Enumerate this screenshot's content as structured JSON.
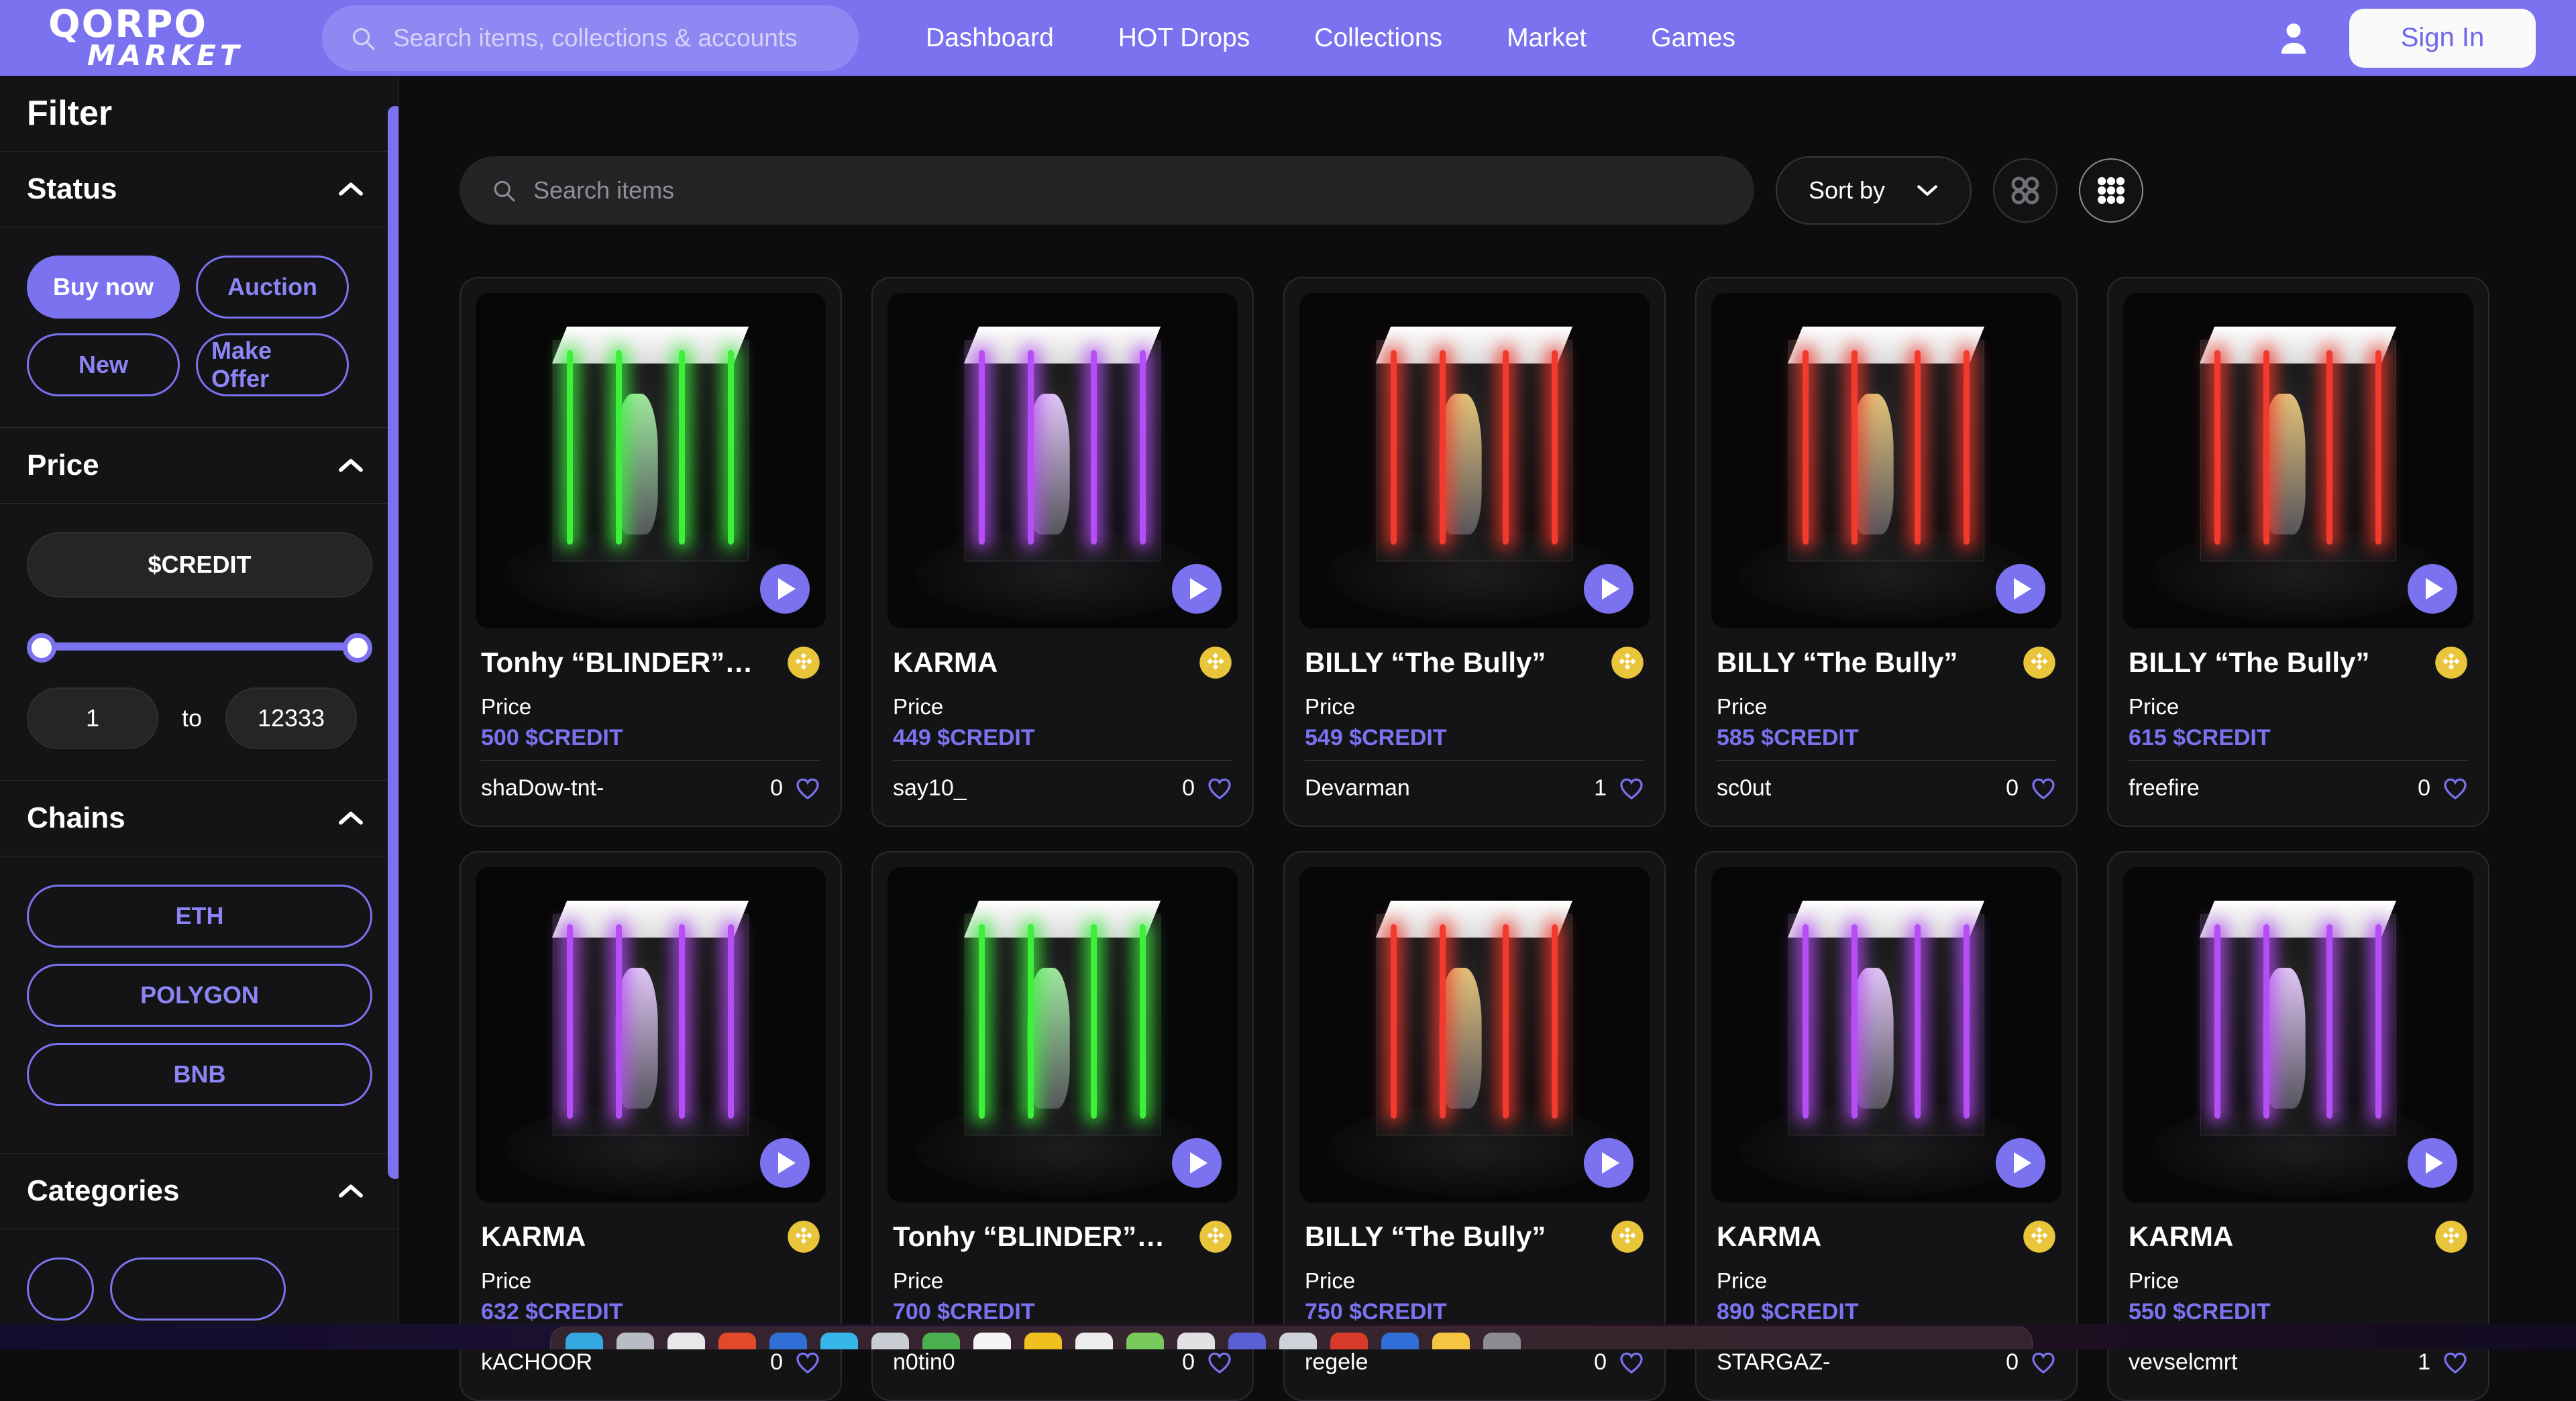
{
  "header": {
    "logo_top": "QORPO",
    "logo_bottom": "MARKET",
    "search_placeholder": "Search items, collections & accounts",
    "search_value": "",
    "nav": [
      {
        "label": "Dashboard"
      },
      {
        "label": "HOT Drops"
      },
      {
        "label": "Collections"
      },
      {
        "label": "Market"
      },
      {
        "label": "Games"
      }
    ],
    "sign_in_label": "Sign In",
    "accent_color": "#7b72f0",
    "signin_text_color": "#6f67e8"
  },
  "sidebar": {
    "title": "Filter",
    "sections": [
      {
        "title": "Status",
        "collapsed": false,
        "chips": [
          {
            "label": "Buy now",
            "active": true
          },
          {
            "label": "Auction",
            "active": false
          },
          {
            "label": "New",
            "active": false
          },
          {
            "label": "Make Offer",
            "active": false
          }
        ]
      },
      {
        "title": "Price",
        "collapsed": false,
        "currency_label": "$CREDIT",
        "min_value": "1",
        "max_value": "12333",
        "to_label": "to"
      },
      {
        "title": "Chains",
        "collapsed": false,
        "chips": [
          {
            "label": "ETH",
            "active": false
          },
          {
            "label": "POLYGON",
            "active": false
          },
          {
            "label": "BNB",
            "active": false
          }
        ]
      },
      {
        "title": "Categories",
        "collapsed": false
      }
    ]
  },
  "toolbar": {
    "search_placeholder": "Search items",
    "search_value": "",
    "sort_label": "Sort by",
    "view_small_label": "grid-4-view",
    "view_large_label": "grid-9-view",
    "active_view": "grid-9-view"
  },
  "grid": {
    "price_label": "Price",
    "cards": [
      {
        "title": "Tonhy “BLINDER”…",
        "price": "500 $CREDIT",
        "seller": "shaDow-tnt-",
        "likes": "0",
        "chain": "bnb",
        "tube": "#3cf03c",
        "fig": "#9fe89f"
      },
      {
        "title": "KARMA",
        "price": "449 $CREDIT",
        "seller": "say10_",
        "likes": "0",
        "chain": "bnb",
        "tube": "#b64ef5",
        "fig": "#e0c6f5"
      },
      {
        "title": "BILLY “The Bully”",
        "price": "549 $CREDIT",
        "seller": "Devarman",
        "likes": "1",
        "chain": "bnb",
        "tube": "#f23b2e",
        "fig": "#e3c27a"
      },
      {
        "title": "BILLY “The Bully”",
        "price": "585 $CREDIT",
        "seller": "sc0ut",
        "likes": "0",
        "chain": "bnb",
        "tube": "#f23b2e",
        "fig": "#e3c27a"
      },
      {
        "title": "BILLY “The Bully”",
        "price": "615 $CREDIT",
        "seller": "freefire",
        "likes": "0",
        "chain": "bnb",
        "tube": "#f23b2e",
        "fig": "#e3c27a"
      },
      {
        "title": "KARMA",
        "price": "632 $CREDIT",
        "seller": "kACHOOR",
        "likes": "0",
        "chain": "bnb",
        "tube": "#b64ef5",
        "fig": "#e0c6f5"
      },
      {
        "title": "Tonhy “BLINDER”…",
        "price": "700 $CREDIT",
        "seller": "n0tin0",
        "likes": "0",
        "chain": "bnb",
        "tube": "#3cf03c",
        "fig": "#9fe89f"
      },
      {
        "title": "BILLY “The Bully”",
        "price": "750 $CREDIT",
        "seller": "regele",
        "likes": "0",
        "chain": "bnb",
        "tube": "#f23b2e",
        "fig": "#e3c27a"
      },
      {
        "title": "KARMA",
        "price": "890 $CREDIT",
        "seller": "STARGAZ-",
        "likes": "0",
        "chain": "bnb",
        "tube": "#b64ef5",
        "fig": "#e0c6f5"
      },
      {
        "title": "KARMA",
        "price": "550 $CREDIT",
        "seller": "vevselcmrt",
        "likes": "1",
        "chain": "bnb",
        "tube": "#b64ef5",
        "fig": "#e0c6f5"
      }
    ]
  },
  "dock": {
    "icons": [
      "#35a7e0",
      "#b9bcc4",
      "#e8e8ea",
      "#e04a2a",
      "#2f6fd6",
      "#39b6e8",
      "#c9ccd2",
      "#4caf50",
      "#f5f5f5",
      "#f0c020",
      "#ececec",
      "#76c95a",
      "#e2e2e4",
      "#5a5fd6",
      "#cfd2d8",
      "#d93b2b",
      "#2f6fd6",
      "#f5c542",
      "#8b8b90"
    ]
  }
}
